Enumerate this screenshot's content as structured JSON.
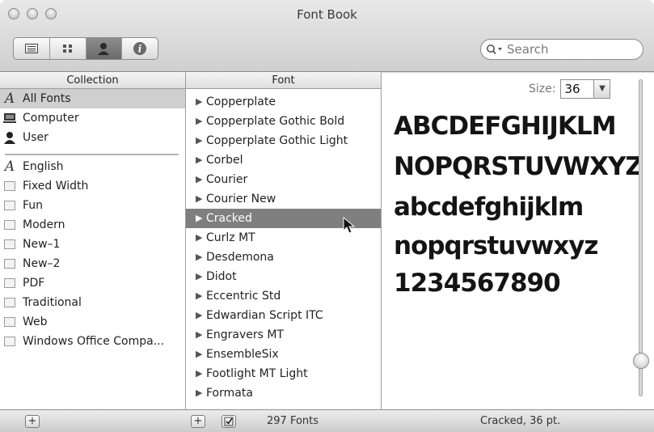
{
  "window": {
    "title": "Font Book"
  },
  "toolbar": {
    "view_buttons": [
      "list-view-icon",
      "grid-view-icon",
      "person-view-icon",
      "info-icon"
    ],
    "search_placeholder": "Search"
  },
  "collection": {
    "header": "Collection",
    "items": [
      {
        "label": "All Fonts",
        "icon": "font-A-icon",
        "selected": true
      },
      {
        "label": "Computer",
        "icon": "computer-icon"
      },
      {
        "label": "User",
        "icon": "user-icon"
      },
      {
        "label": "English",
        "icon": "font-A-icon"
      },
      {
        "label": "Fixed Width",
        "icon": "book-icon"
      },
      {
        "label": "Fun",
        "icon": "book-icon"
      },
      {
        "label": "Modern",
        "icon": "book-icon"
      },
      {
        "label": "New–1",
        "icon": "book-icon"
      },
      {
        "label": "New–2",
        "icon": "book-icon"
      },
      {
        "label": "PDF",
        "icon": "book-icon"
      },
      {
        "label": "Traditional",
        "icon": "book-icon"
      },
      {
        "label": "Web",
        "icon": "book-icon"
      },
      {
        "label": "Windows Office Compa...",
        "icon": "book-icon"
      }
    ]
  },
  "font": {
    "header": "Font",
    "items": [
      {
        "label": "Copperplate"
      },
      {
        "label": "Copperplate Gothic Bold"
      },
      {
        "label": "Copperplate Gothic Light"
      },
      {
        "label": "Corbel"
      },
      {
        "label": "Courier"
      },
      {
        "label": "Courier New"
      },
      {
        "label": "Cracked",
        "selected": true
      },
      {
        "label": "Curlz MT"
      },
      {
        "label": "Desdemona"
      },
      {
        "label": "Didot"
      },
      {
        "label": "Eccentric Std"
      },
      {
        "label": "Edwardian Script ITC"
      },
      {
        "label": "Engravers MT"
      },
      {
        "label": "EnsembleSix"
      },
      {
        "label": "Footlight MT Light"
      },
      {
        "label": "Formata"
      }
    ]
  },
  "preview": {
    "size_label": "Size:",
    "size_value": "36",
    "sample_lines": [
      "ABCDEFGHIJKLM",
      "NOPQRSTUVWXYZ",
      "abcdefghijklm",
      "nopqrstuvwxyz",
      "1234567890"
    ]
  },
  "footer": {
    "font_count": "297 Fonts",
    "status": "Cracked, 36 pt."
  }
}
